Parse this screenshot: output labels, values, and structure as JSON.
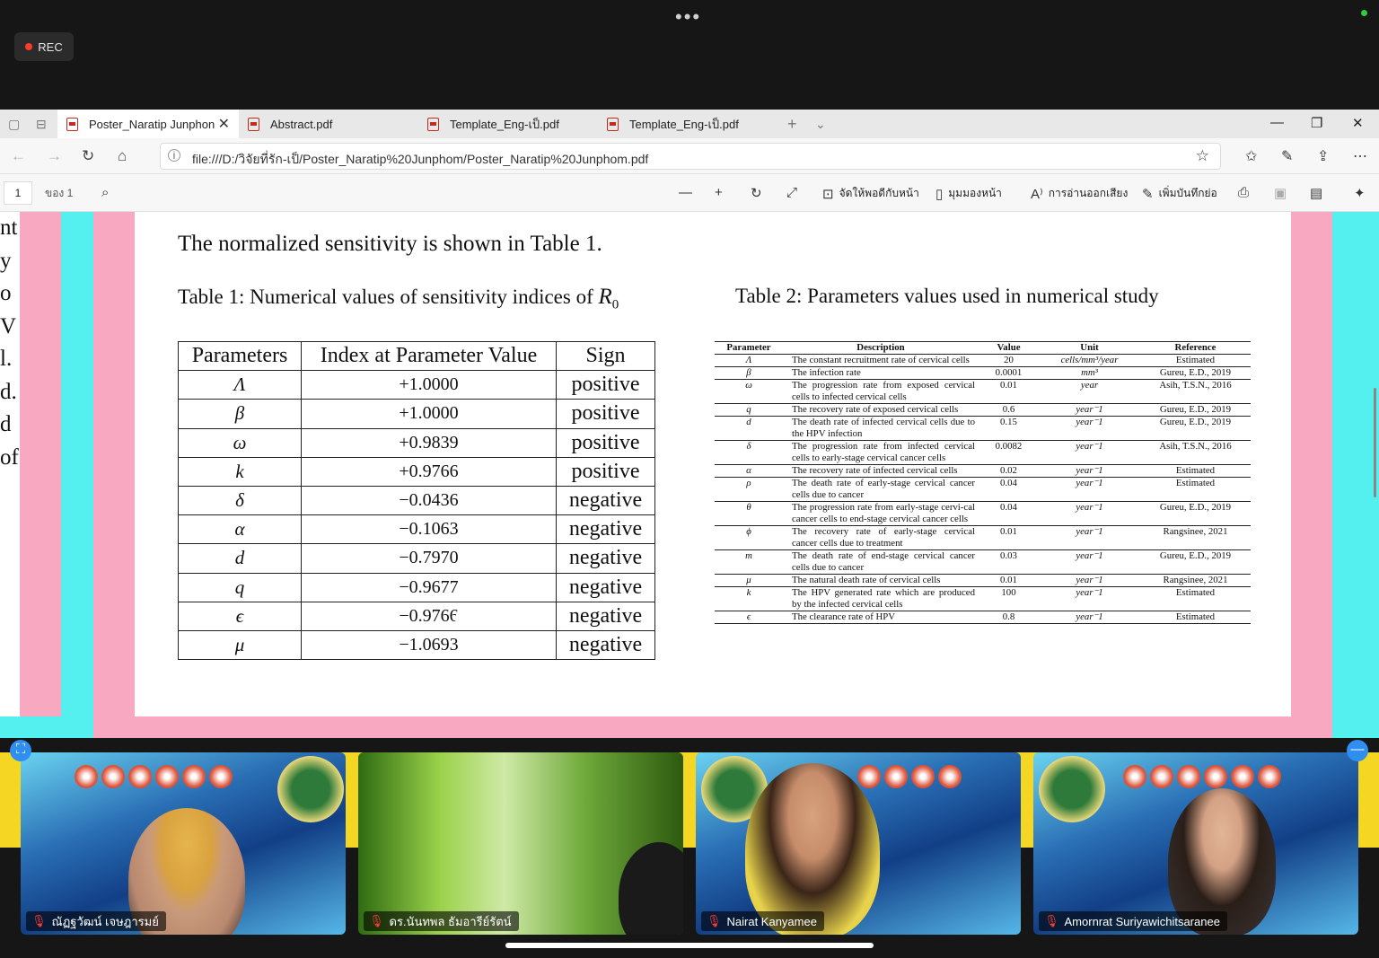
{
  "meeting": {
    "rec_label": "REC",
    "more": "•••"
  },
  "tabs": [
    {
      "label": "Poster_Naratip Junphon",
      "active": true
    },
    {
      "label": "Abstract.pdf"
    },
    {
      "label": "Template_Eng-เป็.pdf"
    },
    {
      "label": "Template_Eng-เป็.pdf"
    }
  ],
  "address": {
    "url": "file:///D:/วิจัยที่รัก-เป็/Poster_Naratip%20Junphom/Poster_Naratip%20Junphom.pdf"
  },
  "pdf_toolbar": {
    "page": "1",
    "of_pages": "ของ 1",
    "fit_label": "จัดให้พอดีกับหน้า",
    "view_label": "มุมมองหน้า",
    "read_aloud_label": "การอ่านออกเสียง",
    "annotate_label": "เพิ่มบันทึกย่อ"
  },
  "left_page_fragments": [
    "nt",
    "y",
    "o",
    "V",
    "l.",
    "d.",
    "d",
    "of"
  ],
  "document": {
    "intro": "The normalized sensitivity is shown in Table 1.",
    "table1": {
      "caption": "Table 1: Numerical values of sensitivity indices of",
      "caption_symbol": "R",
      "caption_sub": "0",
      "headers": [
        "Parameters",
        "Index at Parameter Value",
        "Sign"
      ],
      "rows": [
        [
          "Λ",
          "+1.0000",
          "positive"
        ],
        [
          "β",
          "+1.0000",
          "positive"
        ],
        [
          "ω",
          "+0.9839",
          "positive"
        ],
        [
          "k",
          "+0.9766",
          "positive"
        ],
        [
          "δ",
          "−0.0436",
          "negative"
        ],
        [
          "α",
          "−0.1063",
          "negative"
        ],
        [
          "d",
          "−0.7970",
          "negative"
        ],
        [
          "q",
          "−0.9677",
          "negative"
        ],
        [
          "ϵ",
          "−0.9766",
          "negative"
        ],
        [
          "μ",
          "−1.0693",
          "negative"
        ]
      ]
    },
    "table2": {
      "caption": "Table 2:  Parameters values used in numerical study",
      "headers": [
        "Parameter",
        "Description",
        "Value",
        "Unit",
        "Reference"
      ],
      "rows": [
        [
          "Λ",
          "The constant recruitment rate of cervical cells",
          "20",
          "cells/mm³/year",
          "Estimated"
        ],
        [
          "β",
          "The infection rate",
          "0.0001",
          "mm³",
          "Gureu, E.D., 2019"
        ],
        [
          "ω",
          "The progression rate from exposed cervical cells to infected cervical cells",
          "0.01",
          "year",
          "Asih, T.S.N., 2016"
        ],
        [
          "q",
          "The recovery rate of exposed cervical cells",
          "0.6",
          "year⁻1",
          "Gureu, E.D., 2019"
        ],
        [
          "d",
          "The death rate of infected cervical cells due to the HPV infection",
          "0.15",
          "year⁻1",
          "Gureu, E.D., 2019"
        ],
        [
          "δ",
          "The progression rate from infected cervical cells to early-stage cervical cancer cells",
          "0.0082",
          "year⁻1",
          "Asih, T.S.N., 2016"
        ],
        [
          "α",
          "The recovery rate of infected cervical cells",
          "0.02",
          "year⁻1",
          "Estimated"
        ],
        [
          "ρ",
          "The death rate of early-stage cervical cancer cells due to cancer",
          "0.04",
          "year⁻1",
          "Estimated"
        ],
        [
          "θ",
          "The progression rate from early-stage cervi-cal cancer cells to end-stage cervical cancer cells",
          "0.04",
          "year⁻1",
          "Gureu, E.D., 2019"
        ],
        [
          "ϕ",
          "The recovery rate of early-stage cervical cancer cells due to treatment",
          "0.01",
          "year⁻1",
          "Rangsinee, 2021"
        ],
        [
          "m",
          "The death rate of end-stage cervical cancer cells due to cancer",
          "0.03",
          "year⁻1",
          "Gureu, E.D., 2019"
        ],
        [
          "μ",
          "The natural death rate of cervical cells",
          "0.01",
          "year⁻1",
          "Rangsinee, 2021"
        ],
        [
          "k",
          "The HPV generated rate which are produced by the infected cervical cells",
          "100",
          "year⁻1",
          "Estimated"
        ],
        [
          "ϵ",
          "The clearance rate of HPV",
          "0.8",
          "year⁻1",
          "Estimated"
        ]
      ]
    }
  },
  "participants": [
    {
      "name": "ณัฏฐวัฒน์ เจษฎารมย์"
    },
    {
      "name": "ดร.นันทพล ธัมอารีย์รัตน์"
    },
    {
      "name": "Nairat Kanyamee"
    },
    {
      "name": "Amornrat Suriyawichitsaranee"
    }
  ],
  "colors": {
    "poster_pink": "#f8a8c0",
    "poster_cyan": "#54f0ef",
    "banner_yellow": "#f5d623",
    "rec_red": "#ff3b30"
  }
}
